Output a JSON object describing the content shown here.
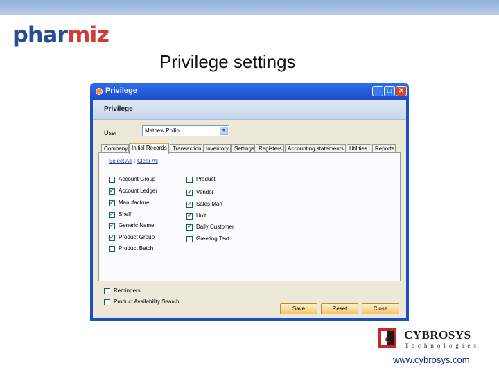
{
  "slide": {
    "logo_part1": "phar",
    "logo_part2": "miz",
    "title": "Privilege settings"
  },
  "window": {
    "title": "Privilege",
    "header": "Privilege",
    "user_label": "User",
    "user_value": "Mathew Philip",
    "tabs": [
      "Company",
      "Initial Records",
      "Transaction",
      "Inventory",
      "Settings",
      "Registers",
      "Accounting statements",
      "Utilities",
      "Reports"
    ],
    "active_tab": "Initial Records",
    "select_all": "Select All",
    "clear_all": "Clear All",
    "separator": "|",
    "left_items": [
      {
        "label": "Account Group",
        "checked": false
      },
      {
        "label": "Account Ledger",
        "checked": true
      },
      {
        "label": "Manufacture",
        "checked": true
      },
      {
        "label": "Shelf",
        "checked": true
      },
      {
        "label": "Generic Name",
        "checked": true
      },
      {
        "label": "Product Group",
        "checked": true
      },
      {
        "label": "Product Batch",
        "checked": false
      }
    ],
    "right_items": [
      {
        "label": "Product",
        "checked": false
      },
      {
        "label": "Vendor",
        "checked": true
      },
      {
        "label": "Sales Man",
        "checked": true
      },
      {
        "label": "Unit",
        "checked": true
      },
      {
        "label": "Daily Customer",
        "checked": true
      },
      {
        "label": "Greeting Text",
        "checked": false
      }
    ],
    "bottom_items": [
      {
        "label": "Reminders",
        "checked": false
      },
      {
        "label": "Product Availability Search",
        "checked": false
      }
    ],
    "buttons": {
      "save": "Save",
      "reset": "Reset",
      "close": "Close"
    }
  },
  "footer": {
    "company": "CYBROSYS",
    "tagline": "Technologies",
    "url": "www.cybrosys.com"
  },
  "colors": {
    "accent_blue": "#1f4fbf",
    "tab_highlight": "#f2a640",
    "check_green": "#21a121",
    "button_fill": "#f3c66a"
  }
}
